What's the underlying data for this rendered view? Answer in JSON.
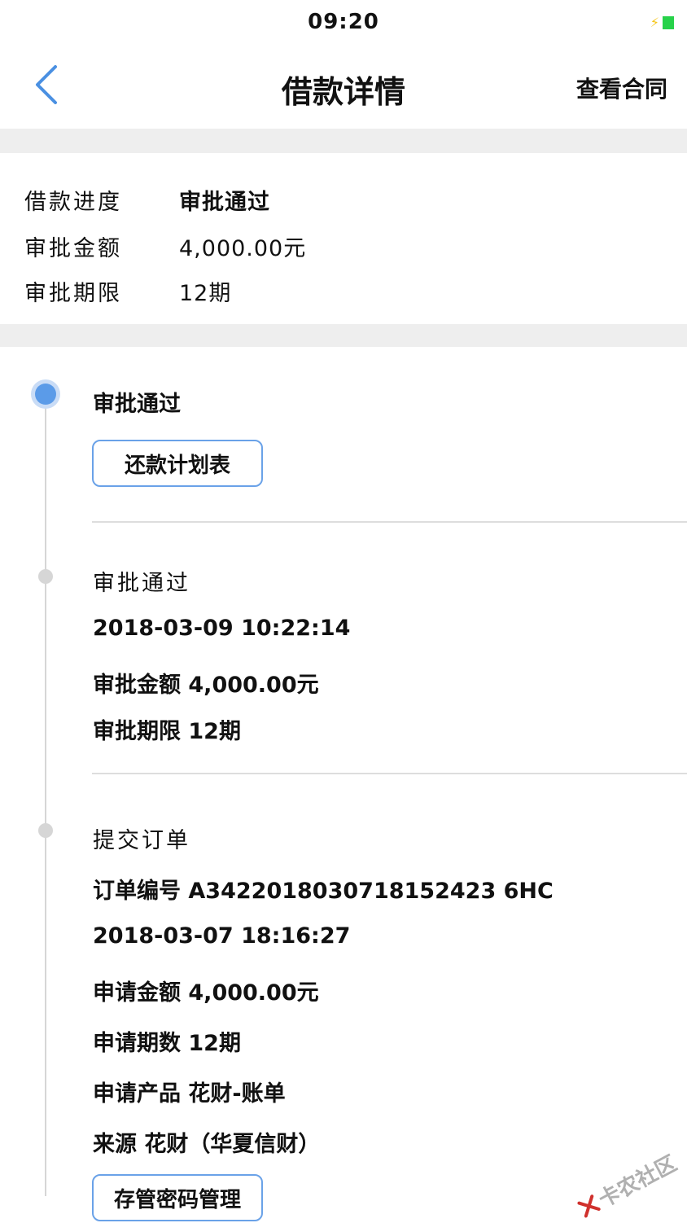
{
  "status_bar": {
    "time": "09:20"
  },
  "nav": {
    "title": "借款详情",
    "right_action": "查看合同"
  },
  "summary": [
    {
      "label": "借款进度",
      "value": "审批通过"
    },
    {
      "label": "审批金额",
      "value": "4,000.00元"
    },
    {
      "label": "审批期限",
      "value": "12期"
    }
  ],
  "timeline": {
    "current": {
      "title": "审批通过",
      "button": "还款计划表"
    },
    "approved": {
      "title": "审批通过",
      "datetime": "2018-03-09 10:22:14",
      "amount": "审批金额 4,000.00元",
      "term": "审批期限 12期"
    },
    "submitted": {
      "title": "提交订单",
      "order_no": "订单编号 A3422018030718152423 6HC",
      "datetime": "2018-03-07 18:16:27",
      "amount": "申请金额 4,000.00元",
      "periods": "申请期数 12期",
      "product": "申请产品 花财-账单",
      "source": "来源 花财（华夏信财）",
      "button": "存管密码管理"
    }
  },
  "watermark": "卡农社区",
  "colors": {
    "accent": "#5b9be8",
    "back_arrow": "#4a90e2",
    "divider": "#dddddd",
    "gap": "#eeeeee"
  }
}
